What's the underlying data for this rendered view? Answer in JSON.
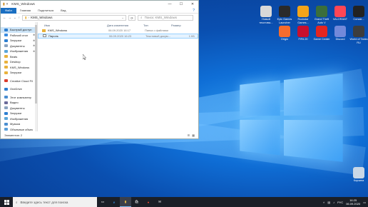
{
  "window": {
    "title": "KMS_Windows",
    "controls": {
      "minimize": "—",
      "maximize": "☐",
      "close": "✕"
    }
  },
  "ribbon": {
    "tabs": [
      "Файл",
      "Главная",
      "Поделиться",
      "Вид"
    ],
    "help": "?"
  },
  "address": {
    "path": "KMS_Windows",
    "search_placeholder": "Поиск: KMS_Windows"
  },
  "sidebar": {
    "items": [
      {
        "label": "Быстрый доступ",
        "icon": "star-icon",
        "selected": true,
        "pinned": false
      },
      {
        "label": "Рабочий стол",
        "icon": "desktop-icon",
        "pinned": true
      },
      {
        "label": "Загрузки",
        "icon": "download-icon",
        "pinned": true
      },
      {
        "label": "Документы",
        "icon": "documents-icon",
        "pinned": true
      },
      {
        "label": "Изображения",
        "icon": "pictures-icon",
        "pinned": true
      },
      {
        "label": "Beats",
        "icon": "folder-icon"
      },
      {
        "label": "Desktop",
        "icon": "folder-icon"
      },
      {
        "label": "KMS_Windows",
        "icon": "folder-icon"
      },
      {
        "label": "Загрузки",
        "icon": "folder-icon"
      },
      {
        "label": "",
        "icon": "spacer"
      },
      {
        "label": "Creative Cloud Fil",
        "icon": "cloud-icon"
      },
      {
        "label": "",
        "icon": "spacer"
      },
      {
        "label": "OneDrive",
        "icon": "onedrive-icon"
      },
      {
        "label": "",
        "icon": "spacer"
      },
      {
        "label": "Этот компьютер",
        "icon": "computer-icon"
      },
      {
        "label": "Видео",
        "icon": "video-icon"
      },
      {
        "label": "Документы",
        "icon": "documents-icon"
      },
      {
        "label": "Загрузки",
        "icon": "download-icon"
      },
      {
        "label": "Изображения",
        "icon": "pictures-icon"
      },
      {
        "label": "Музыка",
        "icon": "music-icon"
      },
      {
        "label": "Объемные объек",
        "icon": "3d-icon"
      }
    ]
  },
  "files": {
    "columns": [
      "Имя",
      "Дата изменения",
      "Тип",
      "Размер"
    ],
    "rows": [
      {
        "name": "KMS_Windows",
        "date": "06.09.2020 16:17",
        "type": "Папка с файлами",
        "size": "",
        "icon": "folder-icon",
        "selected": false
      },
      {
        "name": "Пароль",
        "date": "06.09.2020 16:23",
        "type": "Текстовый докум...",
        "size": "1 КБ",
        "icon": "text-file-icon",
        "selected": true
      }
    ]
  },
  "status": {
    "text": "Элементов: 2"
  },
  "desktop_icons": [
    {
      "label": "Новый текстовы...",
      "color": "#d8d8d8"
    },
    {
      "label": "Epic Games Launcher",
      "color": "#2a2a2a"
    },
    {
      "label": "Rockstar Games...",
      "color": "#f3a41a"
    },
    {
      "label": "Grand Theft Auto V",
      "color": "#3b6e3b"
    },
    {
      "label": "VALORANT",
      "color": "#ff4655"
    },
    {
      "label": "Corsair...",
      "color": "#222222"
    },
    {
      "label": "Origin",
      "color": "#f56c2d"
    },
    {
      "label": "FIFA 20",
      "color": "#c8102e"
    },
    {
      "label": "Game Center",
      "color": "#e52620"
    },
    {
      "label": "Discord",
      "color": "#7289da"
    },
    {
      "label": "World of Tanks RU",
      "color": "#3d3d3d"
    },
    {
      "label": "Корзина",
      "color": "#c9d7e6"
    }
  ],
  "taskbar": {
    "search_placeholder": "Введите здесь текст для поиска",
    "apps": [
      "task-view",
      "edge",
      "explorer",
      "store",
      "yandex",
      "mail"
    ],
    "tray": {
      "language": "РУС",
      "time": "16:25",
      "date": "06.09.2020"
    }
  }
}
